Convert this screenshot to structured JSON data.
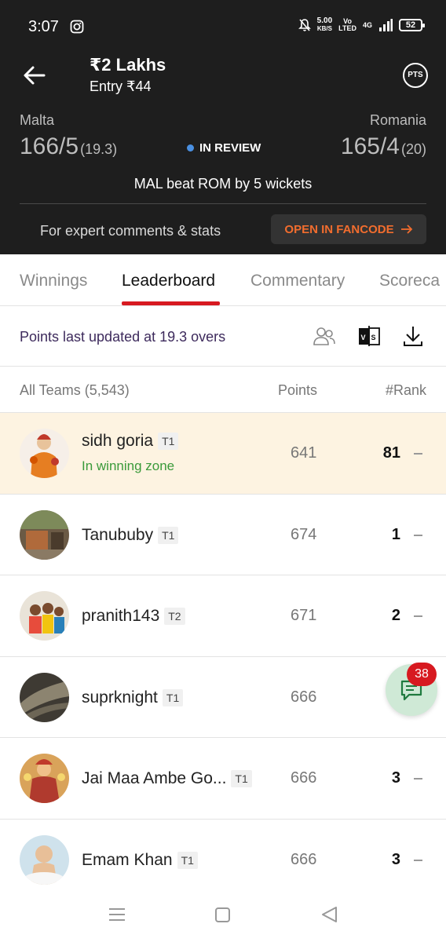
{
  "status_bar": {
    "time": "3:07",
    "net_speed_value": "5.00",
    "net_speed_unit": "KB/S",
    "volte_top": "Vo",
    "volte_bottom": "LTED",
    "network": "4G",
    "battery": "52",
    "icons": [
      "instagram-icon",
      "mute-bell-icon",
      "signal-icon",
      "battery-icon"
    ]
  },
  "header": {
    "contest_title": "₹2 Lakhs",
    "entry": "Entry ₹44",
    "pts_label": "PTS"
  },
  "match": {
    "team_left": "Malta",
    "score_left": "166/5",
    "overs_left": "(19.3)",
    "status": "IN REVIEW",
    "team_right": "Romania",
    "score_right": "165/4",
    "overs_right": "(20)",
    "result": "MAL beat ROM by 5 wickets"
  },
  "fancode": {
    "text": "For expert comments & stats",
    "button": "OPEN IN FANCODE"
  },
  "tabs": [
    {
      "label": "Winnings",
      "active": false
    },
    {
      "label": "Leaderboard",
      "active": true
    },
    {
      "label": "Commentary",
      "active": false
    },
    {
      "label": "Scoreca",
      "active": false
    }
  ],
  "info": {
    "updated_text": "Points last updated at 19.3 overs"
  },
  "columns": {
    "teams": "All Teams (5,543)",
    "points": "Points",
    "rank": "#Rank"
  },
  "rows": [
    {
      "name": "sidh goria",
      "tag": "T1",
      "zone": "In winning zone",
      "points": "641",
      "rank": "81",
      "highlight": true
    },
    {
      "name": "Tanububy",
      "tag": "T1",
      "points": "674",
      "rank": "1"
    },
    {
      "name": "pranith143",
      "tag": "T2",
      "points": "671",
      "rank": "2"
    },
    {
      "name": "suprknight",
      "tag": "T1",
      "points": "666",
      "rank": ""
    },
    {
      "name": "Jai Maa Ambe Go...",
      "tag": "T1",
      "points": "666",
      "rank": "3"
    },
    {
      "name": "Emam Khan",
      "tag": "T1",
      "points": "666",
      "rank": "3"
    }
  ],
  "chat": {
    "badge": "38"
  },
  "colors": {
    "header_bg": "#1e1e1e",
    "accent_red": "#d71920",
    "fancode_orange": "#f26d2e",
    "highlight_row": "#fdf3e1",
    "winning_green": "#3a9a3a"
  }
}
